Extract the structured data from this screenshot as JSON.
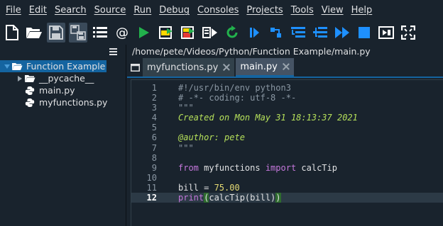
{
  "menu": [
    "File",
    "Edit",
    "Search",
    "Source",
    "Run",
    "Debug",
    "Consoles",
    "Projects",
    "Tools",
    "View",
    "Help"
  ],
  "toolbar": [
    {
      "name": "new-file-icon"
    },
    {
      "name": "open-folder-icon"
    },
    {
      "name": "save-icon",
      "active": true
    },
    {
      "name": "save-all-icon",
      "active": true
    },
    {
      "name": "outline-list-icon"
    },
    {
      "name": "at-symbol-icon"
    },
    {
      "name": "run-icon"
    },
    {
      "name": "run-cell-icon"
    },
    {
      "name": "run-cell-advance-icon"
    },
    {
      "name": "run-selection-icon"
    },
    {
      "name": "rerun-icon"
    },
    {
      "name": "debug-icon"
    },
    {
      "name": "step-icon"
    },
    {
      "name": "step-into-icon"
    },
    {
      "name": "step-return-icon"
    },
    {
      "name": "continue-icon"
    },
    {
      "name": "stop-icon"
    },
    {
      "name": "maximize-pane-icon"
    },
    {
      "name": "fullscreen-icon"
    }
  ],
  "project": {
    "root": "Function Example",
    "children": [
      "__pycache__",
      "main.py",
      "myfunctions.py"
    ]
  },
  "editor": {
    "path": "/home/pete/Videos/Python/Function Example/main.py",
    "tabs": [
      "myfunctions.py",
      "main.py"
    ],
    "active_tab": 1,
    "current_line": 12,
    "lines": [
      {
        "n": "1",
        "tokens": [
          {
            "t": "#!/usr/bin/env python3",
            "c": "comment"
          }
        ]
      },
      {
        "n": "2",
        "tokens": [
          {
            "t": "# -*- coding: utf-8 -*-",
            "c": "comment"
          }
        ]
      },
      {
        "n": "3",
        "tokens": [
          {
            "t": "\"\"\"",
            "c": "string"
          }
        ]
      },
      {
        "n": "4",
        "tokens": [
          {
            "t": "Created on Mon May 31 18:13:37 2021",
            "c": "doc"
          }
        ]
      },
      {
        "n": "5",
        "tokens": []
      },
      {
        "n": "6",
        "tokens": [
          {
            "t": "@author: pete",
            "c": "doc"
          }
        ]
      },
      {
        "n": "7",
        "tokens": [
          {
            "t": "\"\"\"",
            "c": "string"
          }
        ]
      },
      {
        "n": "8",
        "tokens": []
      },
      {
        "n": "9",
        "tokens": [
          {
            "t": "from",
            "c": "keyword"
          },
          {
            "t": " myfunctions ",
            "c": "plain"
          },
          {
            "t": "import",
            "c": "keyword"
          },
          {
            "t": " calcTip",
            "c": "plain"
          }
        ]
      },
      {
        "n": "10",
        "tokens": []
      },
      {
        "n": "11",
        "tokens": [
          {
            "t": "bill = ",
            "c": "plain"
          },
          {
            "t": "75.00",
            "c": "number"
          }
        ]
      },
      {
        "n": "12",
        "tokens": [
          {
            "t": "print",
            "c": "builtin"
          },
          {
            "t": "(",
            "c": "paren"
          },
          {
            "t": "calcTip(bill)",
            "c": "plain"
          },
          {
            "t": ")",
            "c": "paren"
          }
        ]
      }
    ]
  }
}
